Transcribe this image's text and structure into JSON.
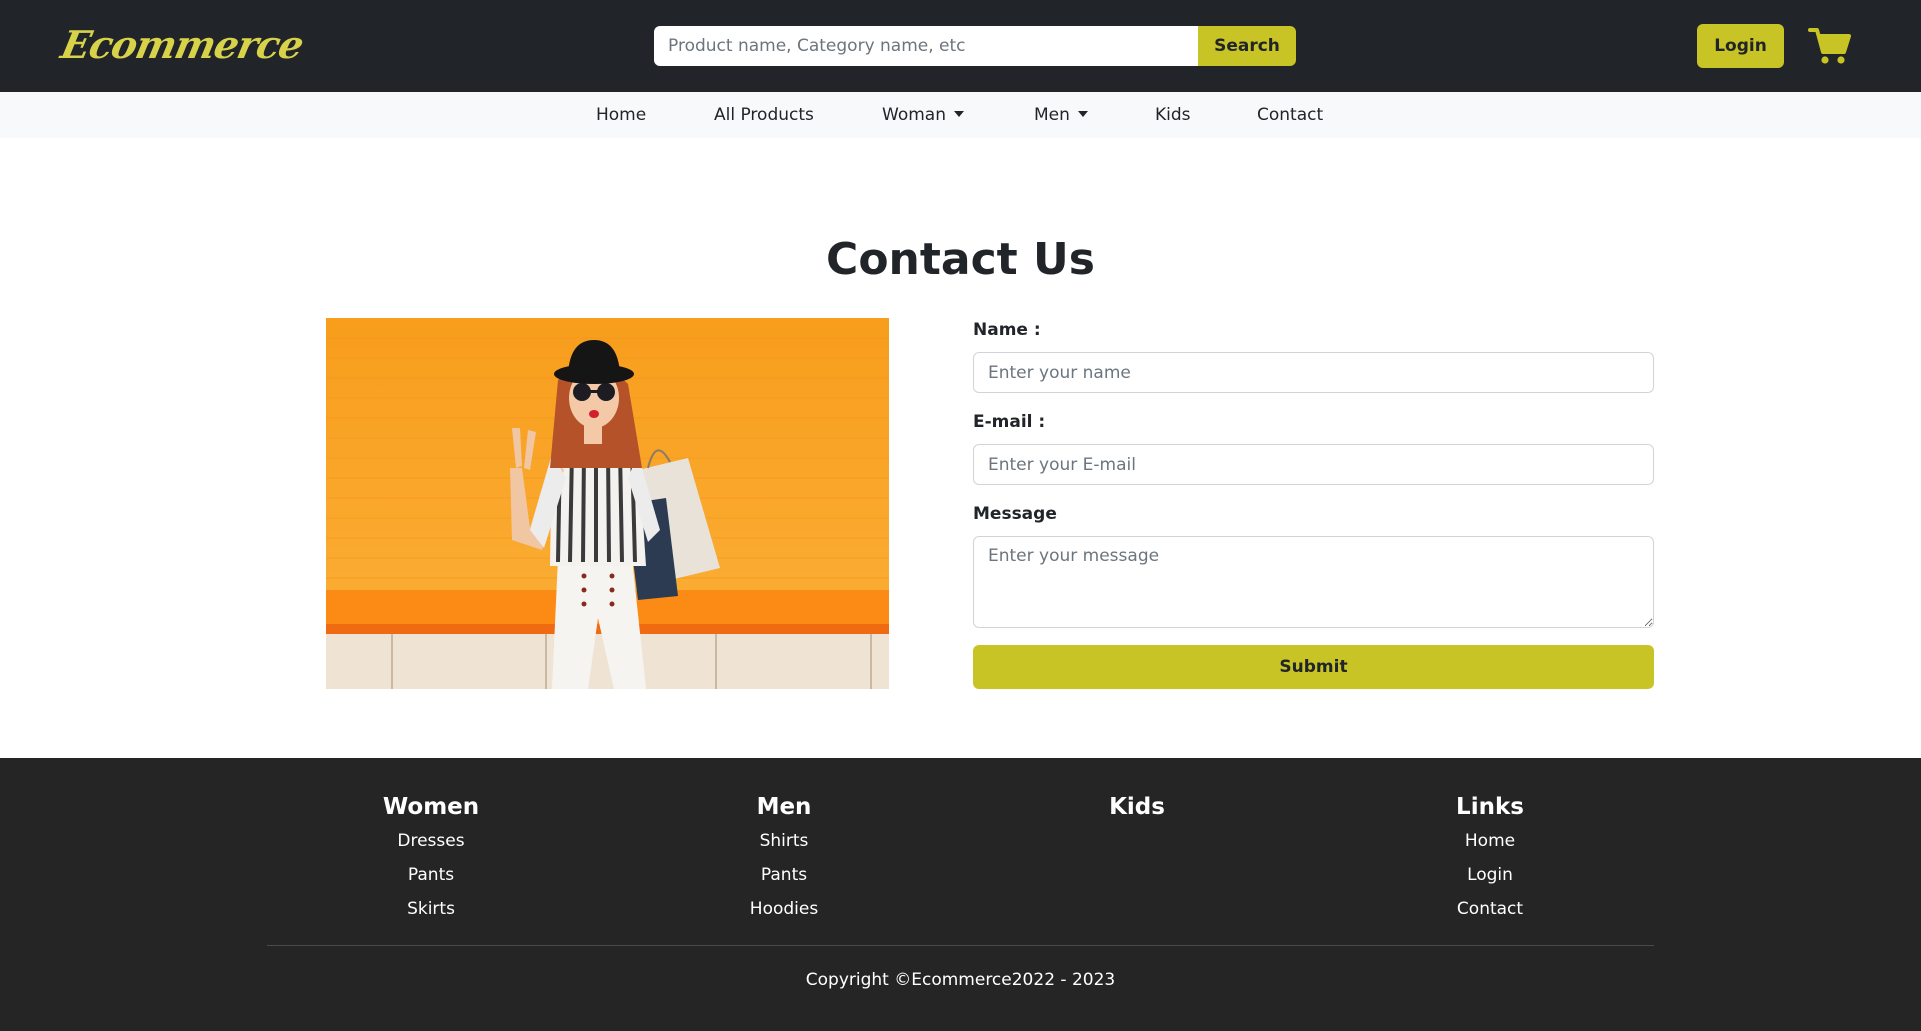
{
  "header": {
    "logo": "Ecommerce",
    "search_placeholder": "Product name, Category name, etc",
    "search_button": "Search",
    "login_button": "Login",
    "cart_icon": "shopping-cart-icon",
    "accent_color": "#c8c425",
    "logo_color": "#d8d24a",
    "bg_color": "#212529"
  },
  "nav": {
    "items": [
      {
        "label": "Home"
      },
      {
        "label": "All Products"
      },
      {
        "label": "Woman",
        "dropdown": true
      },
      {
        "label": "Men",
        "dropdown": true
      },
      {
        "label": "Kids"
      },
      {
        "label": "Contact"
      }
    ]
  },
  "contact": {
    "title": "Contact Us",
    "name_label": "Name :",
    "name_placeholder": "Enter your name",
    "email_label": "E-mail :",
    "email_placeholder": "Enter your E-mail",
    "message_label": "Message",
    "message_placeholder": "Enter your message",
    "submit_button": "Submit"
  },
  "footer": {
    "columns": [
      {
        "title": "Women",
        "links": [
          "Dresses",
          "Pants",
          "Skirts"
        ]
      },
      {
        "title": "Men",
        "links": [
          "Shirts",
          "Pants",
          "Hoodies"
        ]
      },
      {
        "title": "Kids",
        "links": []
      },
      {
        "title": "Links",
        "links": [
          "Home",
          "Login",
          "Contact"
        ]
      }
    ],
    "copyright": "Copyright ©Ecommerce2022 - 2023",
    "bg_color": "#252525"
  }
}
